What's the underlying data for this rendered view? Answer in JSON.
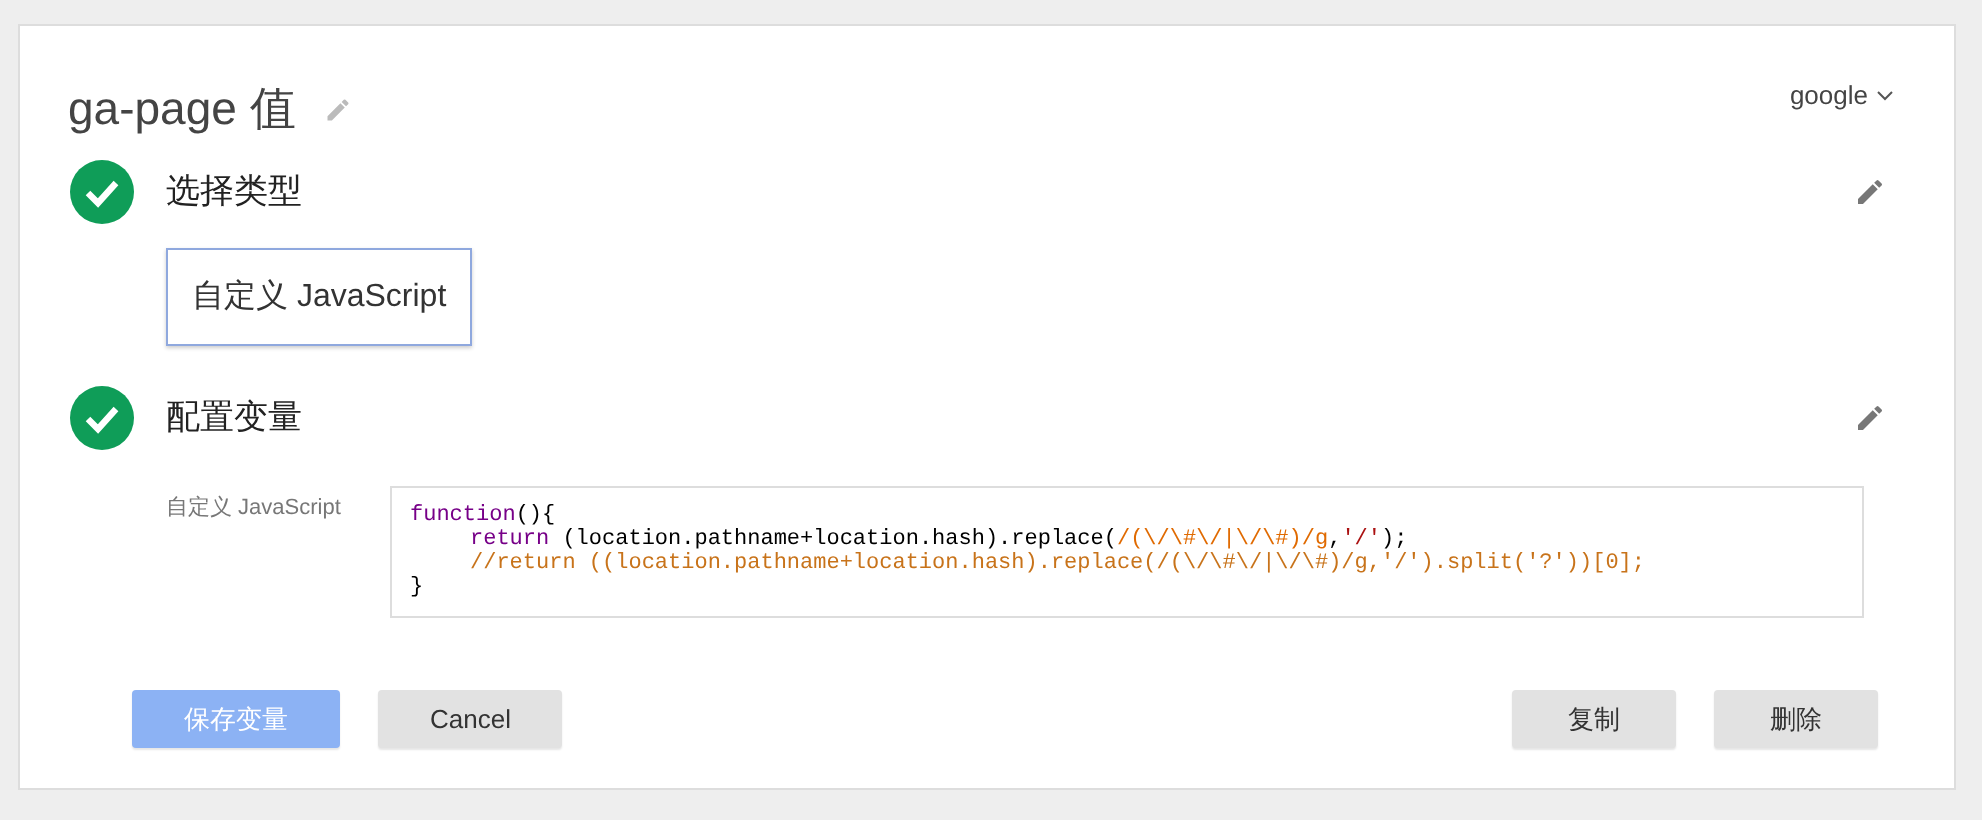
{
  "header": {
    "title": "ga-page 值",
    "workspace": "google"
  },
  "steps": [
    {
      "title": "选择类型",
      "done": true,
      "kind": "type",
      "value": "自定义 JavaScript"
    },
    {
      "title": "配置变量",
      "done": true,
      "kind": "config",
      "field_label": "自定义 JavaScript",
      "code": [
        {
          "indented": false,
          "segments": [
            {
              "kind": "keyword",
              "text": "function"
            },
            {
              "kind": "plain",
              "text": "(){"
            }
          ]
        },
        {
          "indented": true,
          "segments": [
            {
              "kind": "keyword",
              "text": "return"
            },
            {
              "kind": "plain",
              "text": " (location.pathname+location.hash).replace("
            },
            {
              "kind": "regex",
              "text": "/(\\/\\#\\/|\\/\\#)/g"
            },
            {
              "kind": "plain",
              "text": ","
            },
            {
              "kind": "string",
              "text": "'/'"
            },
            {
              "kind": "plain",
              "text": ");"
            }
          ]
        },
        {
          "indented": true,
          "segments": [
            {
              "kind": "comment",
              "text": "//return ((location.pathname+location.hash).replace(/(\\/\\#\\/|\\/\\#)/g,'/').split('?'))[0];"
            }
          ]
        },
        {
          "indented": false,
          "segments": [
            {
              "kind": "plain",
              "text": "}"
            }
          ]
        }
      ]
    }
  ],
  "buttons_left": [
    {
      "label": "保存变量",
      "kind": "primary",
      "disabled": true
    },
    {
      "label": "Cancel",
      "kind": "secondary",
      "disabled": false
    }
  ],
  "buttons_right": [
    {
      "label": "复制",
      "kind": "secondary",
      "disabled": false
    },
    {
      "label": "删除",
      "kind": "secondary",
      "disabled": false
    }
  ]
}
